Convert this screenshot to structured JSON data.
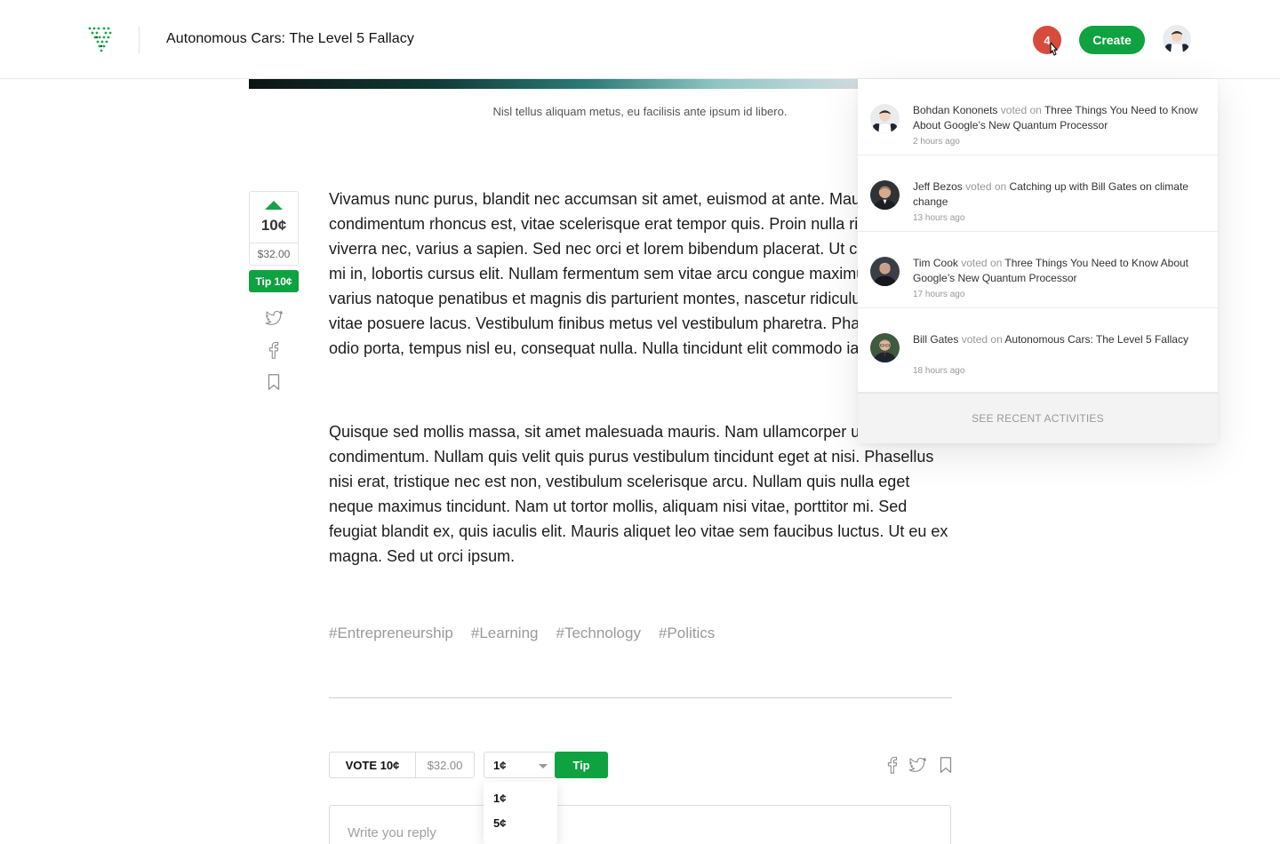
{
  "header": {
    "title": "Autonomous Cars: The Level 5 Fallacy",
    "notification_count": "4",
    "create_label": "Create"
  },
  "hero": {
    "caption": "Nisl tellus aliquam metus, eu facilisis ante ipsum id libero."
  },
  "vote_rail": {
    "count": "10¢",
    "amount": "$32.00",
    "tip_label": "Tip 10¢"
  },
  "article": {
    "paragraph_1": "Vivamus nunc purus, blandit nec accumsan sit amet, euismod at ante. Mauris condimentum rhoncus est, vitae scelerisque erat tempor quis. Proin nulla risus, non viverra nec, varius a sapien. Sed nec orci et lorem bibendum placerat. Ut commodo eu mi in, lobortis cursus elit. Nullam fermentum sem vitae arcu congue maximus. Orci varius natoque penatibus et magnis dis parturient montes, nascetur ridiculus mus. Nunc vitae posuere lacus. Vestibulum finibus metus vel vestibulum pharetra. Phasellus ut odio porta, tempus nisl eu, consequat nulla. Nulla tincidunt elit commodo iaculis.",
    "paragraph_2": "Quisque sed mollis massa, sit amet malesuada mauris. Nam ullamcorper urna condimentum. Nullam quis velit quis purus vestibulum tincidunt eget at nisi. Phasellus nisi erat, tristique nec est non, vestibulum scelerisque arcu. Nullam quis nulla eget neque maximus tincidunt. Nam ut tortor mollis, aliquam nisi vitae, porttitor mi. Sed feugiat blandit ex, quis iaculis elit. Mauris aliquet leo vitae sem faucibus luctus. Ut eu ex magna. Sed ut orci ipsum.",
    "tags": [
      "#Entrepreneurship",
      "#Learning",
      "#Technology",
      "#Politics"
    ]
  },
  "actions": {
    "vote_label": "VOTE 10¢",
    "vote_amount": "$32.00",
    "tip_selected": "1¢",
    "tip_button": "Tip",
    "tip_options": [
      "1¢",
      "5¢"
    ],
    "reply_placeholder": "Write you reply"
  },
  "notifications": {
    "items": [
      {
        "who": "Bohdan Kononets",
        "verb": "voted on",
        "what": "Three Things You Need to Know About Google’s New Quantum Processor",
        "time": "2 hours ago"
      },
      {
        "who": "Jeff Bezos",
        "verb": "voted on",
        "what": "Catching up with Bill Gates on climate change",
        "time": "13 hours ago"
      },
      {
        "who": "Tim Cook",
        "verb": "voted on",
        "what": "Three Things You Need to Know About Google’s New Quantum Processor",
        "time": "17 hours ago"
      },
      {
        "who": "Bill Gates",
        "verb": "voted on",
        "what": "Autonomous Cars: The Level 5 Fallacy",
        "time": "18 hours ago"
      }
    ],
    "see_all_label": "SEE RECENT ACTIVITIES"
  },
  "icons": {
    "logo": "logo-icon",
    "twitter": "twitter-icon",
    "facebook": "facebook-icon",
    "bookmark": "bookmark-icon",
    "cursor": "cursor-icon"
  },
  "colors": {
    "accent_green": "#0ea240",
    "badge_red": "#d84a3c",
    "tag_gray": "#9a9a9a"
  }
}
